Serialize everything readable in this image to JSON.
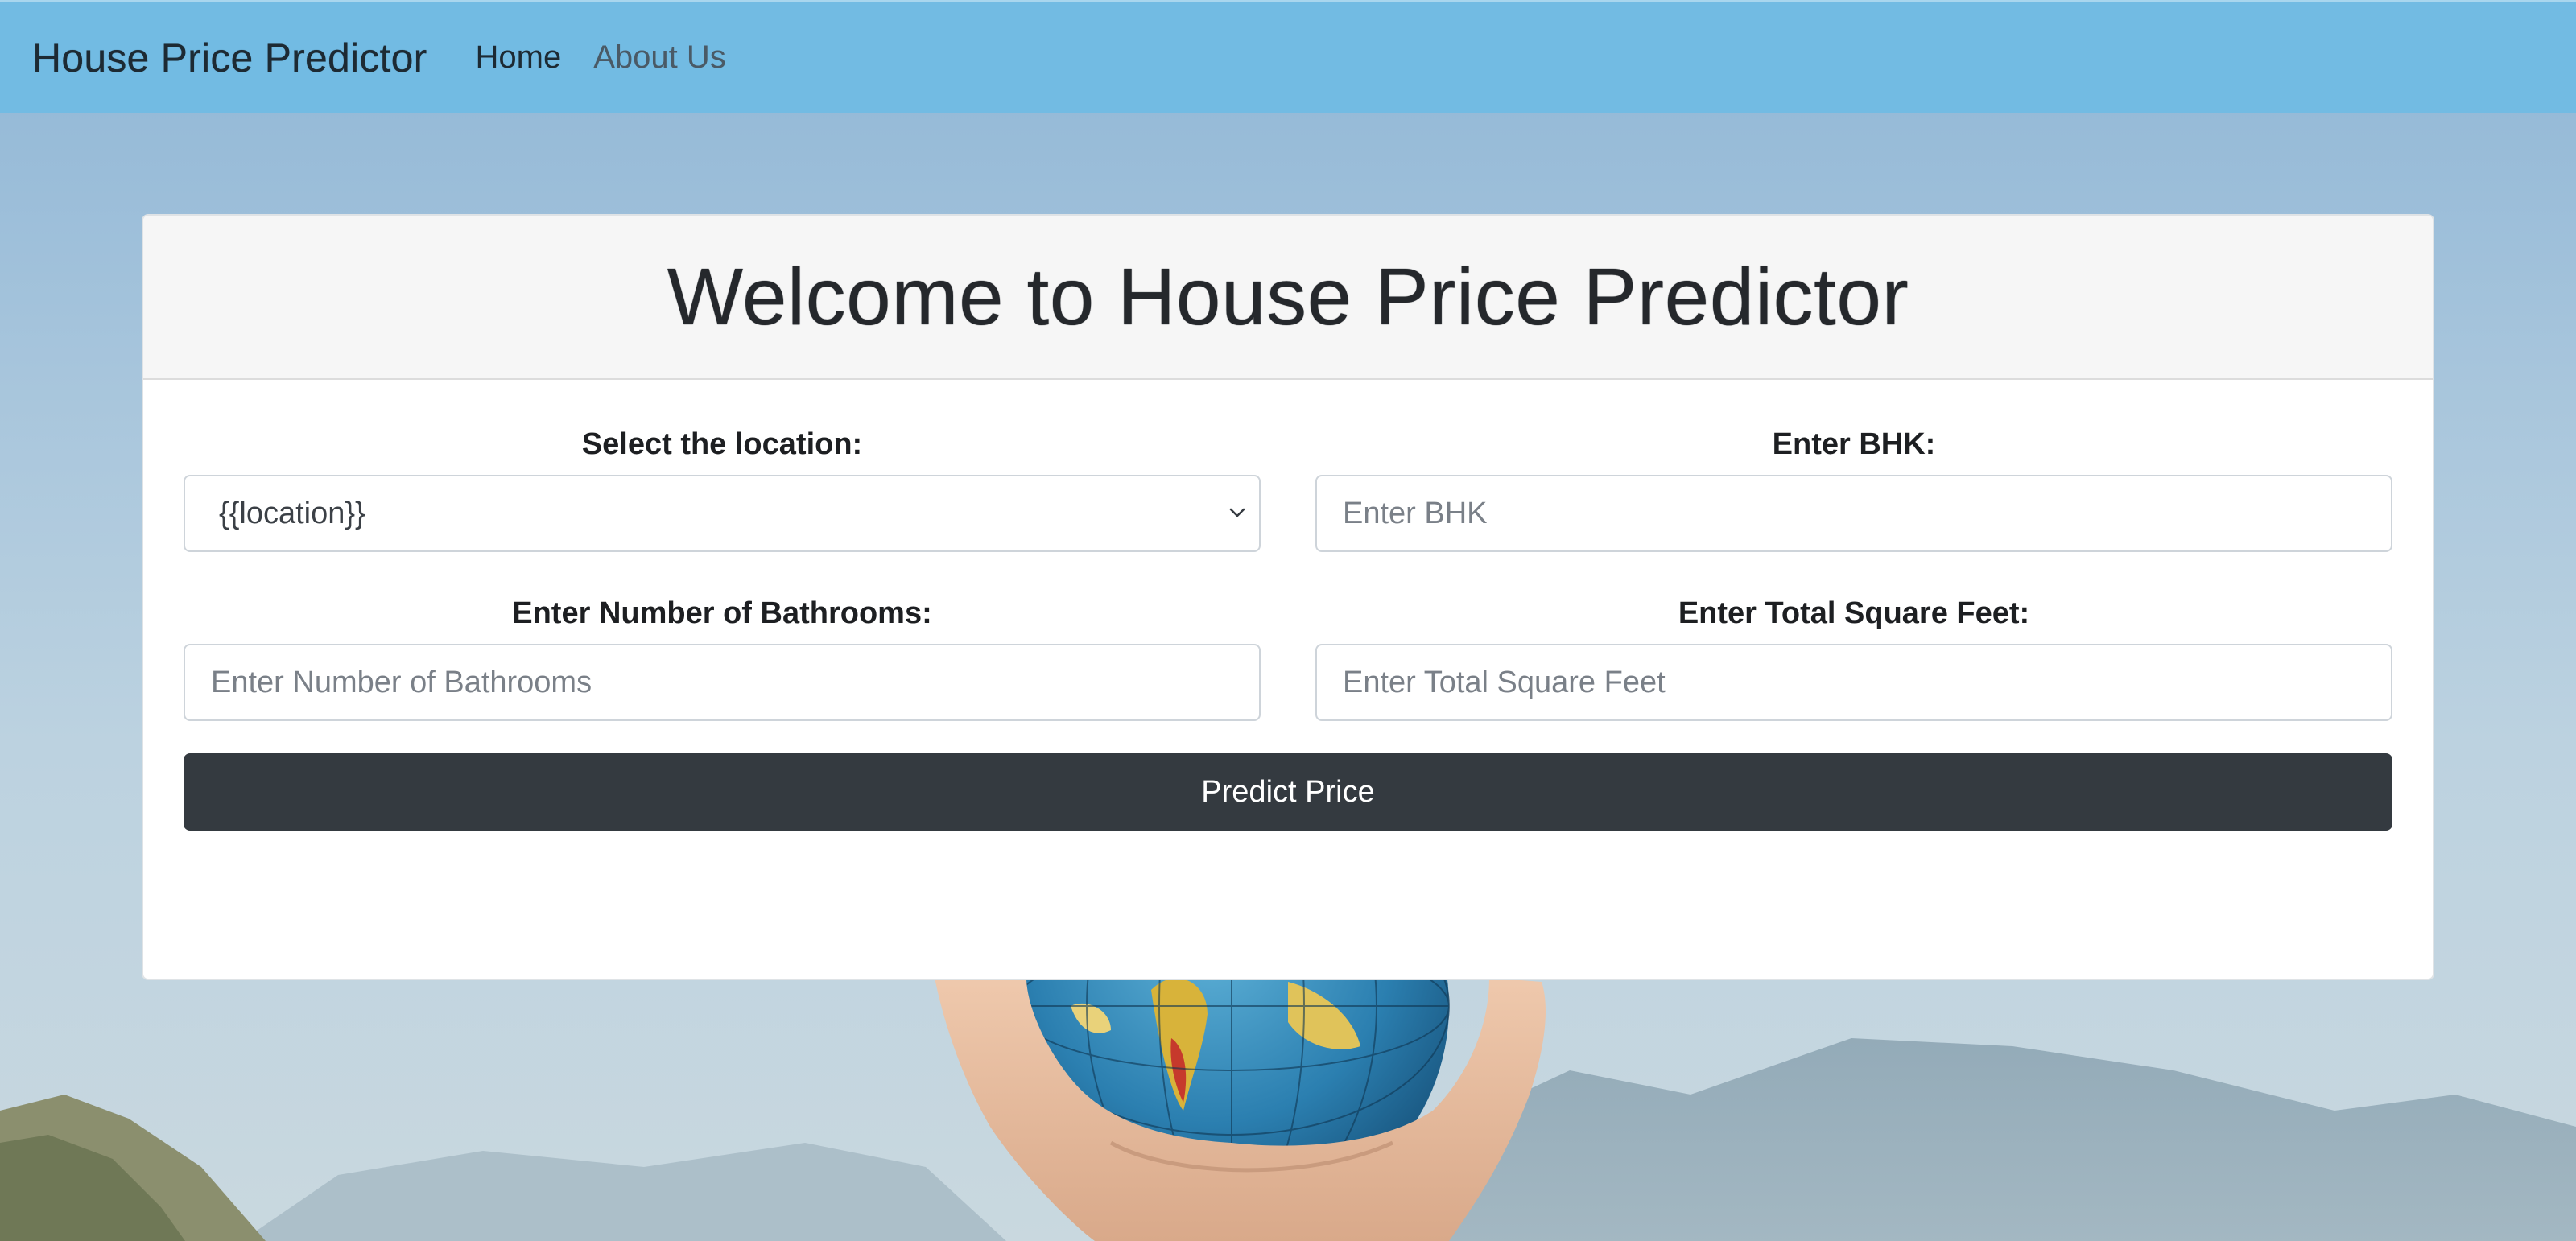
{
  "navbar": {
    "brand": "House Price Predictor",
    "links": [
      {
        "label": "Home",
        "active": true
      },
      {
        "label": "About Us",
        "active": false
      }
    ],
    "background_color": "#72bbe3"
  },
  "card": {
    "title": "Welcome to House Price Predictor"
  },
  "form": {
    "location": {
      "label": "Select the location:",
      "selected_value": "{{location}}"
    },
    "bhk": {
      "label": "Enter BHK:",
      "value": "",
      "placeholder": "Enter BHK"
    },
    "bathrooms": {
      "label": "Enter Number of Bathrooms:",
      "value": "",
      "placeholder": "Enter Number of Bathrooms"
    },
    "sqft": {
      "label": "Enter Total Square Feet:",
      "value": "",
      "placeholder": "Enter Total Square Feet"
    },
    "submit_label": "Predict Price",
    "submit_color": "#343a40"
  },
  "background": {
    "image_subject": "hand holding globe over mountains",
    "sky_color": "#a7c5dc"
  }
}
